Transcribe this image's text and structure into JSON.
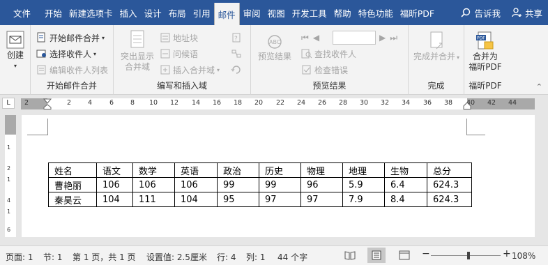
{
  "tabs": {
    "file": "文件",
    "home": "开始",
    "newtab": "新建选项卡",
    "insert": "插入",
    "design": "设计",
    "layout": "布局",
    "references": "引用",
    "mailings": "邮件",
    "review": "审阅",
    "view": "视图",
    "developer": "开发工具",
    "help": "帮助",
    "special": "特色功能",
    "foxit": "福昕PDF",
    "tellme": "告诉我",
    "share": "共享"
  },
  "ribbon": {
    "create": "创建",
    "start_merge": {
      "start_merge_button": "开始邮件合并",
      "select_recipients": "选择收件人",
      "edit_recipients": "编辑收件人列表",
      "label": "开始邮件合并"
    },
    "write_insert": {
      "highlight_line1": "突出显示",
      "highlight_line2": "合并域",
      "address_block": "地址块",
      "greeting": "问候语",
      "insert_field": "插入合并域",
      "label": "编写和插入域"
    },
    "preview": {
      "preview_results": "预览结果",
      "find_recipient": "查找收件人",
      "check_errors": "检查错误",
      "label": "预览结果"
    },
    "finish": {
      "finish_merge": "完成并合并",
      "label": "完成"
    },
    "foxit_pdf": {
      "merge_line1": "合并为",
      "merge_line2": "福昕PDF",
      "label": "福昕PDF"
    }
  },
  "ruler": {
    "corner": "L",
    "numbers": [
      "2",
      "2",
      "4",
      "6",
      "8",
      "10",
      "12",
      "14",
      "16",
      "18",
      "20",
      "22",
      "24",
      "26",
      "28",
      "30",
      "32",
      "34",
      "36",
      "38",
      "40",
      "42",
      "44"
    ],
    "vnumbers": [
      "1",
      "2",
      "1",
      "4",
      "1",
      "6"
    ]
  },
  "table": {
    "header": [
      "姓名",
      "语文",
      "数学",
      "英语",
      "政治",
      "历史",
      "物理",
      "地理",
      "生物",
      "总分"
    ],
    "rows": [
      [
        "曹艳丽",
        "106",
        "106",
        "106",
        "99",
        "99",
        "96",
        "5.9",
        "6.4",
        "624.3"
      ],
      [
        "秦昊云",
        "104",
        "111",
        "104",
        "95",
        "97",
        "97",
        "7.9",
        "8.4",
        "624.3"
      ]
    ]
  },
  "status": {
    "page": "页面: 1",
    "section": "节: 1",
    "pages": "第 1 页，共 1 页",
    "setting": "设置值: 2.5厘米",
    "line": "行: 4",
    "col": "列: 1",
    "chars": "44 个字",
    "zoom": "108%"
  }
}
